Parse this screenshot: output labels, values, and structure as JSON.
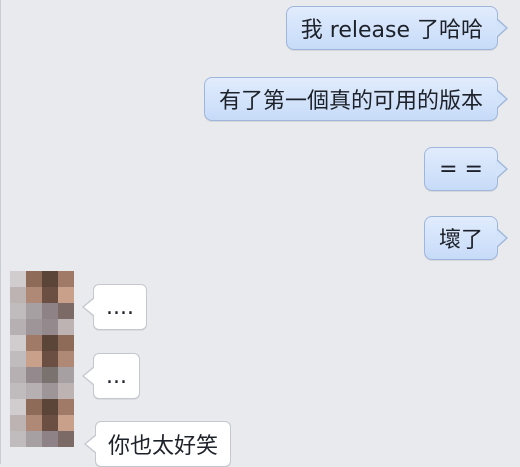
{
  "conversation": {
    "messages": [
      {
        "side": "out",
        "text": "我 release 了哈哈"
      },
      {
        "side": "out",
        "text": "有了第一個真的可用的版本"
      },
      {
        "side": "out",
        "text": "= ="
      },
      {
        "side": "out",
        "text": "壞了"
      },
      {
        "side": "in",
        "text": "...."
      },
      {
        "side": "in",
        "text": "..."
      },
      {
        "side": "in",
        "text": "你也太好笑"
      }
    ]
  },
  "avatar": {
    "description": "pixelated-avatar",
    "colors": [
      "#8e6a58",
      "#5a4538",
      "#a07a66",
      "#7b6a66",
      "#b08976",
      "#6b4f43",
      "#c9a08a",
      "#8f8287",
      "#a7a0a3",
      "#7a726f",
      "#bcb3b2",
      "#94898c",
      "#c0bcbe",
      "#9d9597",
      "#b7b0b2",
      "#d1cccd"
    ]
  }
}
